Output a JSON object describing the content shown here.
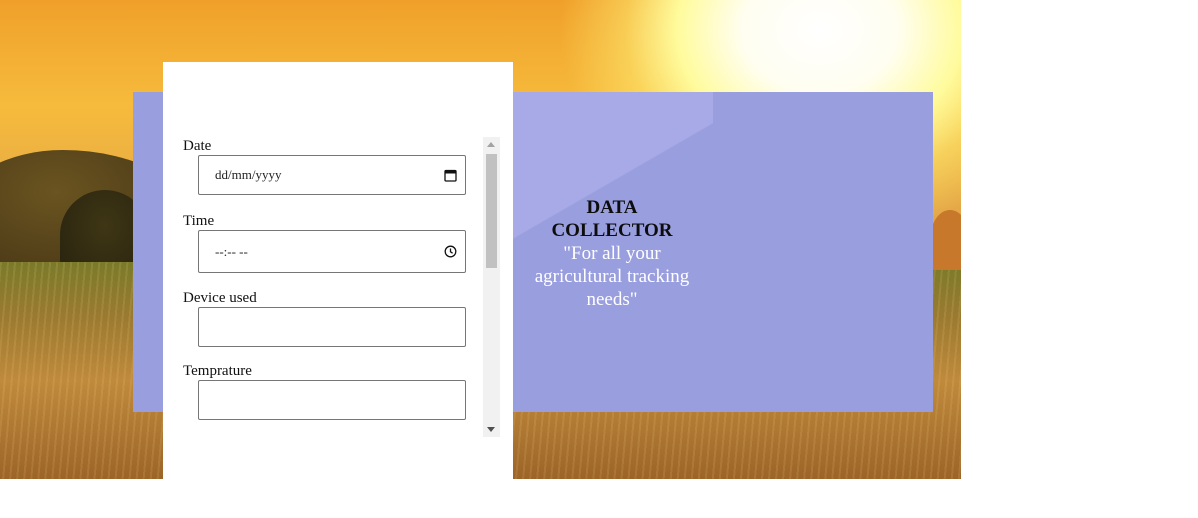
{
  "form": {
    "fields": [
      {
        "label": "Date",
        "placeholder": "dd/mm/yyyy",
        "icon": "calendar-icon"
      },
      {
        "label": "Time",
        "placeholder": "--:-- --",
        "icon": "clock-icon"
      },
      {
        "label": "Device used",
        "placeholder": ""
      },
      {
        "label": "Temprature",
        "placeholder": ""
      }
    ]
  },
  "brand": {
    "title": "DATA COLLECTOR",
    "tagline": "\"For all your agricultural tracking needs\""
  },
  "colors": {
    "card": "#999ede",
    "panel": "#ffffff",
    "title_text": "#0d0d0d",
    "tagline_text": "#ffffff"
  }
}
